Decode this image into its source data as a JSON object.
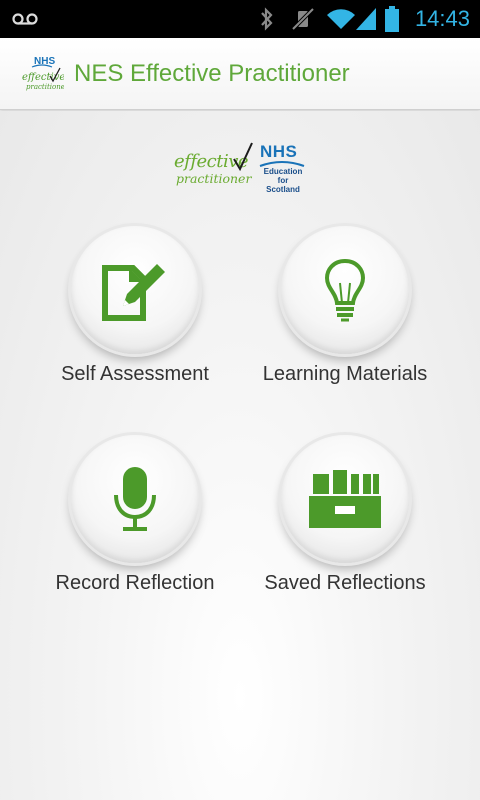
{
  "status_bar": {
    "time": "14:43",
    "icons": [
      "voicemail-icon",
      "bluetooth-icon",
      "vibrate-icon",
      "wifi-icon",
      "signal-icon",
      "battery-icon"
    ],
    "accent_color": "#33b5e5"
  },
  "action_bar": {
    "logo": {
      "nhs": "NHS",
      "effective": "effective",
      "practitioner": "practitioner"
    },
    "title": "NES Effective Practitioner",
    "title_color": "#5fa83a"
  },
  "brand": {
    "effective": "effective",
    "practitioner": "practitioner",
    "nhs": "NHS",
    "nhs_sub_1": "Education",
    "nhs_sub_2": "for",
    "nhs_sub_3": "Scotland"
  },
  "menu": [
    {
      "label": "Self Assessment",
      "icon": "edit-document-icon"
    },
    {
      "label": "Learning Materials",
      "icon": "lightbulb-icon"
    },
    {
      "label": "Record Reflection",
      "icon": "microphone-icon"
    },
    {
      "label": "Saved Reflections",
      "icon": "file-box-icon"
    }
  ],
  "icon_color": "#4c9a2a"
}
